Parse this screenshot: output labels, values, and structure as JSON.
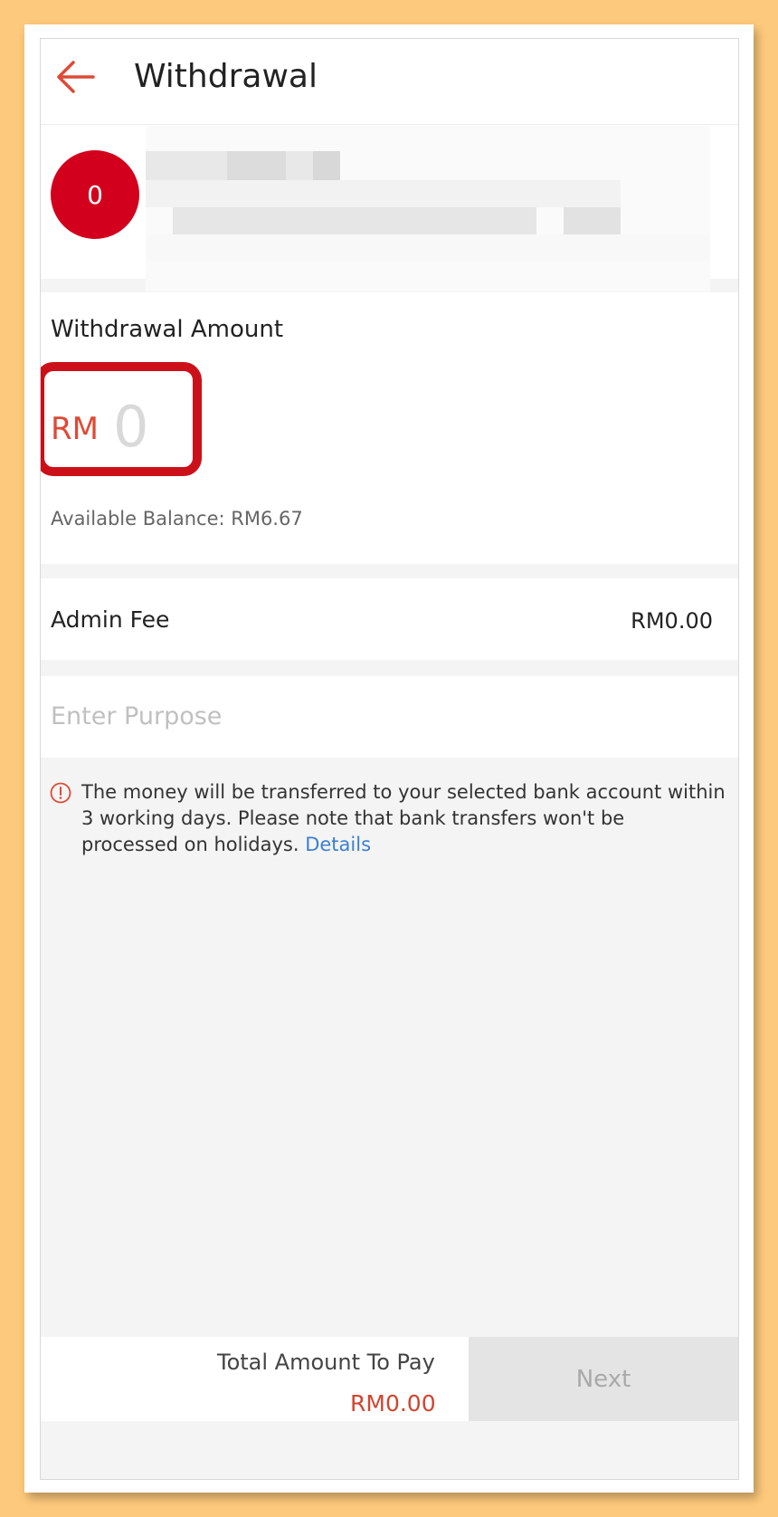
{
  "colors": {
    "accent": "#de4a36",
    "avatar_bg": "#d2001d",
    "highlight": "#cc101a",
    "link": "#3c7fd0",
    "frame_bg": "#fdc97c"
  },
  "header": {
    "back_icon": "arrow-left-icon",
    "title": "Withdrawal"
  },
  "account": {
    "avatar_initial": "0"
  },
  "withdrawal": {
    "label": "Withdrawal Amount",
    "currency": "RM",
    "amount_placeholder": "0",
    "available_balance": "Available Balance: RM6.67"
  },
  "fee": {
    "label": "Admin Fee",
    "value": "RM0.00"
  },
  "purpose": {
    "placeholder": "Enter Purpose"
  },
  "notice": {
    "icon": "info-icon",
    "text": "The money will be transferred to your selected bank account within 3 working days. Please note that bank transfers won't be processed on holidays. ",
    "link_label": "Details"
  },
  "footer": {
    "total_label": "Total Amount To Pay",
    "total_value": "RM0.00",
    "next_label": "Next"
  }
}
